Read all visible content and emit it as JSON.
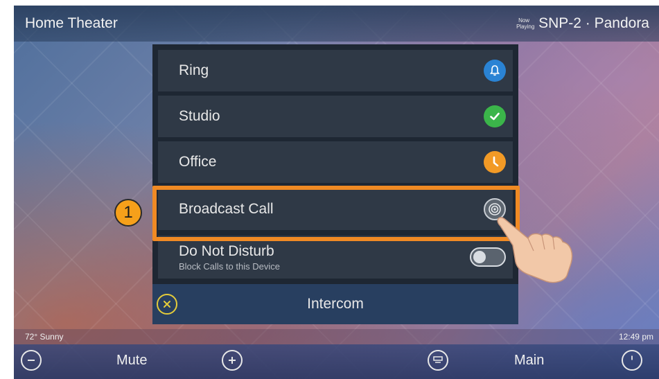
{
  "header": {
    "room_title": "Home Theater",
    "now_playing_label": "Now Playing",
    "source": "SNP-2 · Pandora"
  },
  "menu": {
    "items": [
      {
        "label": "Ring",
        "icon": "bell-icon",
        "icon_color": "#2a83d4"
      },
      {
        "label": "Studio",
        "icon": "check-icon",
        "icon_color": "#3bb54a"
      },
      {
        "label": "Office",
        "icon": "clock-icon",
        "icon_color": "#f29a26"
      },
      {
        "label": "Broadcast Call",
        "icon": "broadcast-icon",
        "icon_color": "#5d6670"
      }
    ],
    "dnd": {
      "label": "Do Not Disturb",
      "sublabel": "Block Calls to this Device",
      "enabled": false
    },
    "footer_title": "Intercom"
  },
  "annotation": {
    "step_number": "1",
    "highlight_color": "#f08a24"
  },
  "status": {
    "weather": "72° Sunny",
    "time": "12:49 pm"
  },
  "bottom_bar": {
    "mute_label": "Mute",
    "main_label": "Main"
  }
}
